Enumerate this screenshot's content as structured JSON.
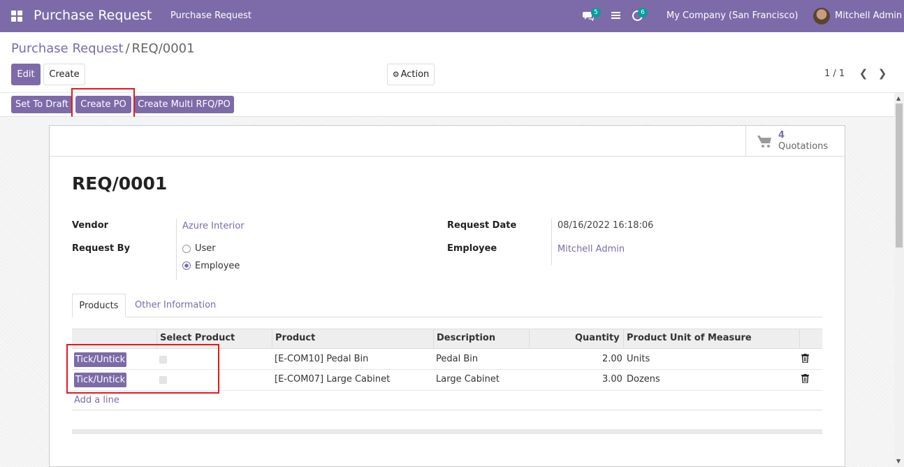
{
  "navbar": {
    "app_title": "Purchase Request",
    "menu_item": "Purchase Request",
    "messages_count": "5",
    "activities_count": "6",
    "company": "My Company (San Francisco)",
    "user": "Mitchell Admin"
  },
  "breadcrumb": {
    "parent": "Purchase Request",
    "separator": "/",
    "current": "REQ/0001"
  },
  "control": {
    "edit_label": "Edit",
    "create_label": "Create",
    "action_label": "Action",
    "pager": "1 / 1"
  },
  "statusbar": {
    "set_to_draft": "Set To Draft",
    "create_po": "Create PO",
    "create_multi": "Create Multi RFQ/PO"
  },
  "smart_button": {
    "value": "4",
    "label": "Quotations"
  },
  "form": {
    "title": "REQ/0001",
    "vendor_label": "Vendor",
    "vendor_value": "Azure Interior",
    "request_by_label": "Request By",
    "request_by_options": [
      "User",
      "Employee"
    ],
    "request_by_selected": "Employee",
    "request_date_label": "Request Date",
    "request_date_value": "08/16/2022 16:18:06",
    "employee_label": "Employee",
    "employee_value": "Mitchell Admin"
  },
  "tabs": [
    "Products",
    "Other Information"
  ],
  "table": {
    "headers": [
      "Select Product",
      "Product",
      "Description",
      "Quantity",
      "Product Unit of Measure"
    ],
    "tick_label": "Tick/Untick",
    "rows": [
      {
        "product": "[E-COM10] Pedal Bin",
        "description": "Pedal Bin",
        "quantity": "2.00",
        "uom": "Units"
      },
      {
        "product": "[E-COM07] Large Cabinet",
        "description": "Large Cabinet",
        "quantity": "3.00",
        "uom": "Dozens"
      }
    ],
    "add_line": "Add a line"
  },
  "colors": {
    "brand": "#7c6ba8",
    "highlight": "#e4181d",
    "badge": "#00a09d"
  }
}
